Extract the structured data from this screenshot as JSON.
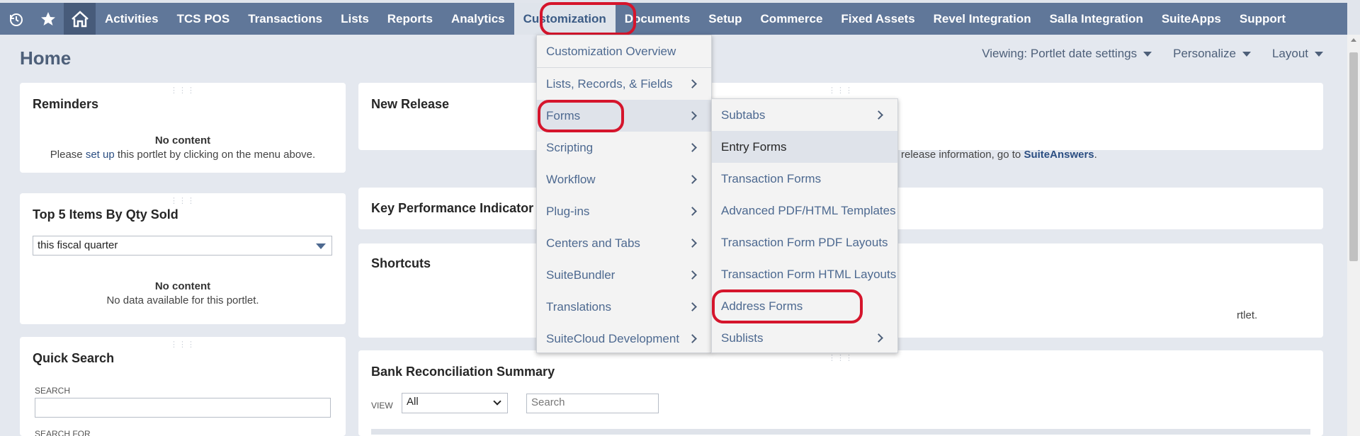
{
  "nav": {
    "icons": [
      "recent-records-icon",
      "star-icon",
      "home-icon"
    ],
    "items": [
      "Activities",
      "TCS POS",
      "Transactions",
      "Lists",
      "Reports",
      "Analytics",
      "Customization",
      "Documents",
      "Setup",
      "Commerce",
      "Fixed Assets",
      "Revel Integration",
      "Salla Integration",
      "SuiteApps",
      "Support"
    ],
    "active": "Customization"
  },
  "page": {
    "title": "Home",
    "viewing": "Viewing: Portlet date settings",
    "personalize": "Personalize",
    "layout": "Layout"
  },
  "reminders": {
    "title": "Reminders",
    "no_content": "No content",
    "msg_prefix": "Please ",
    "msg_link": "set up",
    "msg_suffix": " this portlet by clicking on the menu above."
  },
  "top_items": {
    "title": "Top 5 Items By Qty Sold",
    "filter": "this fiscal quarter",
    "no_content": "No content",
    "msg": "No data available for this portlet."
  },
  "quick_search": {
    "title": "Quick Search",
    "search_label": "SEARCH",
    "search_for_label": "SEARCH FOR"
  },
  "new_release": {
    "title": "New Release",
    "msg_visible": "release information, go to ",
    "msg_link": "SuiteAnswers",
    "msg_end": "."
  },
  "kpi": {
    "title": "Key Performance Indicator"
  },
  "shortcuts": {
    "title": "Shortcuts",
    "msg_visible": "rtlet."
  },
  "bank_rec": {
    "title": "Bank Reconciliation Summary",
    "view_label": "VIEW",
    "view_value": "All",
    "search_placeholder": "Search"
  },
  "customization_menu": {
    "items": [
      {
        "label": "Customization Overview",
        "submenu": false
      },
      {
        "label": "Lists, Records, & Fields",
        "submenu": true
      },
      {
        "label": "Forms",
        "submenu": true
      },
      {
        "label": "Scripting",
        "submenu": true
      },
      {
        "label": "Workflow",
        "submenu": true
      },
      {
        "label": "Plug-ins",
        "submenu": true
      },
      {
        "label": "Centers and Tabs",
        "submenu": true
      },
      {
        "label": "SuiteBundler",
        "submenu": true
      },
      {
        "label": "Translations",
        "submenu": true
      },
      {
        "label": "SuiteCloud Development",
        "submenu": true
      }
    ]
  },
  "forms_menu": {
    "items": [
      {
        "label": "Subtabs",
        "submenu": true
      },
      {
        "label": "Entry Forms",
        "submenu": false
      },
      {
        "label": "Transaction Forms",
        "submenu": false
      },
      {
        "label": "Advanced PDF/HTML Templates",
        "submenu": false
      },
      {
        "label": "Transaction Form PDF Layouts",
        "submenu": false
      },
      {
        "label": "Transaction Form HTML Layouts",
        "submenu": false
      },
      {
        "label": "Address Forms",
        "submenu": false
      },
      {
        "label": "Sublists",
        "submenu": true
      }
    ]
  },
  "colors": {
    "nav_bg": "#607799",
    "highlight": "#d5152c",
    "link": "#2b4e82"
  }
}
